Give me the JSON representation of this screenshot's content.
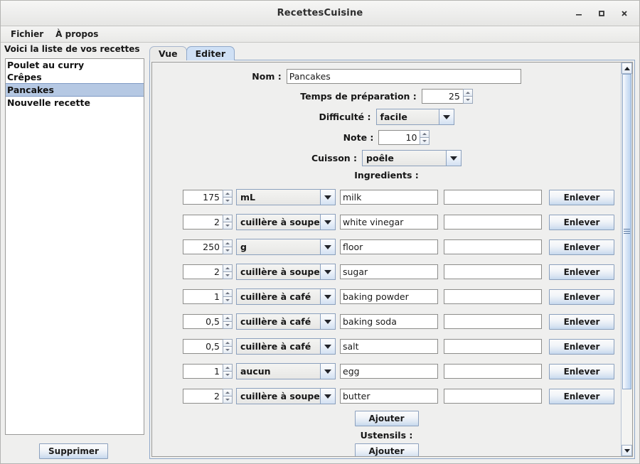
{
  "window": {
    "title": "RecettesCuisine",
    "controls": [
      {
        "name": "minimize-button",
        "glyph": "minimize"
      },
      {
        "name": "maximize-button",
        "glyph": "maximize"
      },
      {
        "name": "close-button",
        "glyph": "close"
      }
    ]
  },
  "menubar": {
    "items": [
      {
        "label": "Fichier"
      },
      {
        "label": "À propos"
      }
    ]
  },
  "sidebar": {
    "heading": "Voici la liste de vos recettes",
    "items": [
      {
        "label": "Poulet au curry",
        "selected": false
      },
      {
        "label": "Crêpes",
        "selected": false
      },
      {
        "label": "Pancakes",
        "selected": true
      },
      {
        "label": "Nouvelle recette",
        "selected": false
      }
    ],
    "delete_button": "Supprimer"
  },
  "tabs": [
    {
      "label": "Vue",
      "active": false
    },
    {
      "label": "Editer",
      "active": true
    }
  ],
  "form": {
    "nom_label": "Nom :",
    "nom_value": "Pancakes",
    "temps_label": "Temps de préparation :",
    "temps_value": "25",
    "difficulte_label": "Difficulté :",
    "difficulte_value": "facile",
    "note_label": "Note :",
    "note_value": "10",
    "cuisson_label": "Cuisson :",
    "cuisson_value": "poêle",
    "ingredients_label": "Ingredients :",
    "ustensils_label": "Ustensils :",
    "add_ingredient_button": "Ajouter",
    "add_ustensil_button": "Ajouter",
    "remove_button": "Enlever"
  },
  "ingredients": [
    {
      "qty": "175",
      "unit": "mL",
      "name": "milk",
      "extra": ""
    },
    {
      "qty": "2",
      "unit": "cuillère à soupe",
      "name": "white vinegar",
      "extra": ""
    },
    {
      "qty": "250",
      "unit": "g",
      "name": "floor",
      "extra": ""
    },
    {
      "qty": "2",
      "unit": "cuillère à soupe",
      "name": "sugar",
      "extra": ""
    },
    {
      "qty": "1",
      "unit": "cuillère à café",
      "name": "baking powder",
      "extra": ""
    },
    {
      "qty": "0,5",
      "unit": "cuillère à café",
      "name": "baking soda",
      "extra": ""
    },
    {
      "qty": "0,5",
      "unit": "cuillère à café",
      "name": "salt",
      "extra": ""
    },
    {
      "qty": "1",
      "unit": "aucun",
      "name": "egg",
      "extra": ""
    },
    {
      "qty": "2",
      "unit": "cuillère à soupe",
      "name": "butter",
      "extra": ""
    }
  ],
  "scrollbar": {
    "thumb_top_percent": 0,
    "thumb_height_percent": 85
  },
  "colors": {
    "selection": "#b5c8e3",
    "active_tab": "#cfe0f5",
    "panel": "#efefee"
  }
}
